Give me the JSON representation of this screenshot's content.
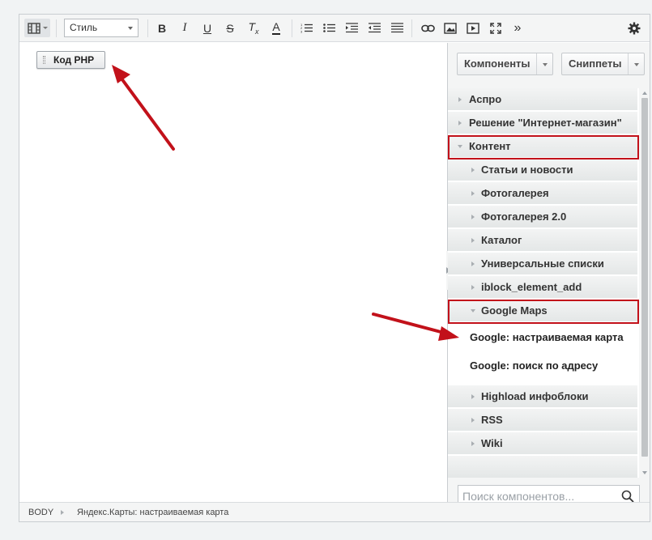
{
  "toolbar": {
    "style_label": "Стиль",
    "icons": [
      "source-icon",
      "bold-icon",
      "italic-icon",
      "underline-icon",
      "strikethrough-icon",
      "remove-format-icon",
      "font-color-icon",
      "numbered-list-icon",
      "bullet-list-icon",
      "indent-icon",
      "outdent-icon",
      "justify-icon",
      "link-icon",
      "image-icon",
      "video-icon",
      "fullscreen-icon",
      "more-icon",
      "settings-icon"
    ],
    "bold": "B",
    "italic": "I",
    "underline": "U",
    "strike": "S",
    "remove_format": "T",
    "remove_format_sub": "x",
    "font_color": "A",
    "more": "»"
  },
  "content": {
    "php_chip_label": "Код PHP"
  },
  "sidepanel": {
    "components_button": "Компоненты",
    "snippets_button": "Сниппеты",
    "tree": {
      "aspro": "Аспро",
      "solution": "Решение \"Интернет-магазин\"",
      "content": "Контент",
      "articles": "Статьи и новости",
      "photogallery": "Фотогалерея",
      "photogallery2": "Фотогалерея 2.0",
      "catalog": "Каталог",
      "universal_lists": "Универсальные списки",
      "iblock_element_add": "iblock_element_add",
      "google_maps": "Google Maps",
      "google_custom_map": "Google: настраиваемая карта",
      "google_address_search": "Google: поиск по адресу",
      "highload": "Highload инфоблоки",
      "rss": "RSS",
      "wiki": "Wiki"
    },
    "search_placeholder": "Поиск компонентов..."
  },
  "statusbar": {
    "crumb_body": "BODY",
    "crumb_component": "Яндекс.Карты: настраиваемая карта"
  },
  "colors": {
    "highlight": "#c2111a",
    "annotation_arrow": "#c2111a"
  }
}
